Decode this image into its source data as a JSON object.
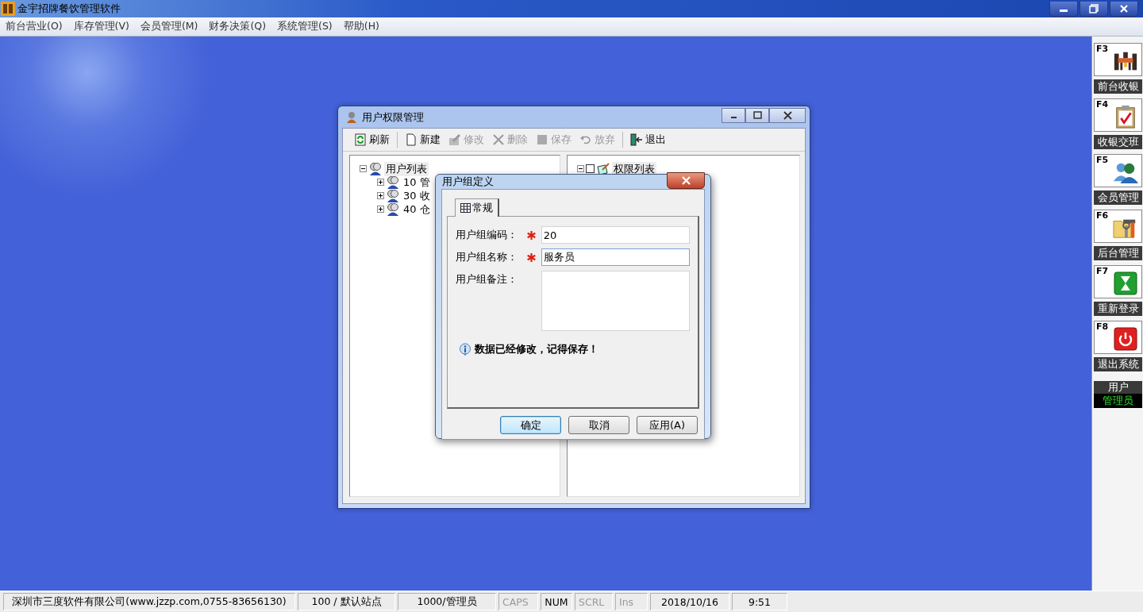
{
  "app": {
    "title": "金宇招牌餐饮管理软件"
  },
  "menu": [
    "前台营业(O)",
    "库存管理(V)",
    "会员管理(M)",
    "财务决策(Q)",
    "系统管理(S)",
    "帮助(H)"
  ],
  "side_panel": {
    "items": [
      {
        "key": "F3",
        "label": "前台收银",
        "kind": "dining"
      },
      {
        "key": "F4",
        "label": "收银交班",
        "kind": "clipboard"
      },
      {
        "key": "F5",
        "label": "会员管理",
        "kind": "people"
      },
      {
        "key": "F6",
        "label": "后台管理",
        "kind": "tools"
      },
      {
        "key": "F7",
        "label": "重新登录",
        "kind": "hourglass"
      },
      {
        "key": "F8",
        "label": "退出系统",
        "kind": "power"
      }
    ],
    "user": {
      "label": "用户",
      "name": "管理员"
    }
  },
  "window": {
    "title": "用户权限管理",
    "toolbar": [
      {
        "label": "刷新",
        "kind": "refresh",
        "disabled": false
      },
      {
        "label": "新建",
        "kind": "new",
        "disabled": false
      },
      {
        "label": "修改",
        "kind": "edit",
        "disabled": true
      },
      {
        "label": "删除",
        "kind": "delete",
        "disabled": true
      },
      {
        "label": "保存",
        "kind": "save",
        "disabled": true
      },
      {
        "label": "放弃",
        "kind": "undo",
        "disabled": true
      },
      {
        "label": "退出",
        "kind": "exit",
        "disabled": false
      }
    ],
    "user_tree": {
      "label": "用户列表",
      "expanded": true,
      "children": [
        {
          "label": "10 管",
          "expanded": false
        },
        {
          "label": "30 收",
          "expanded": false
        },
        {
          "label": "40 仓",
          "expanded": false
        }
      ]
    },
    "permission_tree": {
      "label": "权限列表",
      "expanded": true,
      "checked": false
    }
  },
  "dialog": {
    "title": "用户组定义",
    "tabs": [
      {
        "label": "常规",
        "selected": true
      }
    ],
    "fields": [
      {
        "label": "用户组编码：",
        "required": true,
        "kind": "text",
        "value": "20",
        "focused": false
      },
      {
        "label": "用户组名称：",
        "required": true,
        "kind": "text",
        "value": "服务员",
        "focused": true
      },
      {
        "label": "用户组备注：",
        "required": false,
        "kind": "memo",
        "focused": false
      }
    ],
    "message": "数据已经修改，记得保存！",
    "buttons": [
      {
        "label": "确定",
        "default": true
      },
      {
        "label": "取消",
        "default": false
      },
      {
        "label": "应用(A)",
        "default": false
      }
    ]
  },
  "status_bar": [
    {
      "text": "深圳市三度软件有限公司(www.jzzp.com,0755-83656130)",
      "on": true
    },
    {
      "text": "100 / 默认站点",
      "on": true
    },
    {
      "text": "1000/管理员",
      "on": true
    },
    {
      "text": "CAPS",
      "on": false
    },
    {
      "text": "NUM",
      "on": true
    },
    {
      "text": "SCRL",
      "on": false
    },
    {
      "text": "Ins",
      "on": false
    },
    {
      "text": "2018/10/16",
      "on": true
    },
    {
      "text": "9:51",
      "on": true
    }
  ]
}
